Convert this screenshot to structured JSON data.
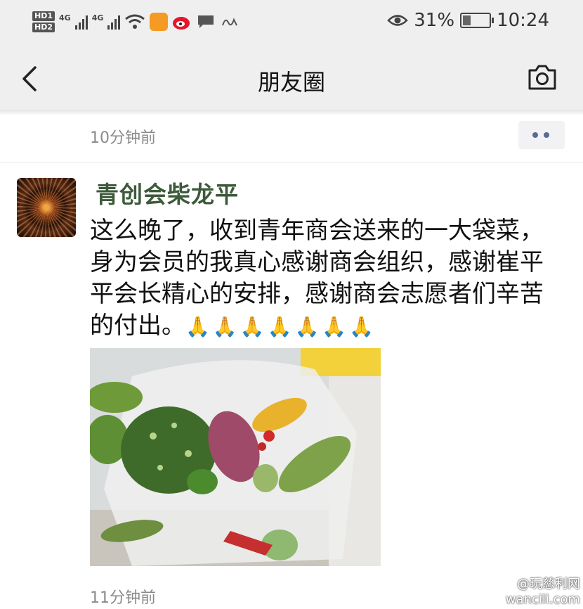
{
  "status_bar": {
    "sim1": "HD1",
    "sim2": "HD2",
    "net1": "4G",
    "net2": "4G",
    "battery_percent": "31%",
    "battery_level": 0.31,
    "time": "10:24",
    "icons": [
      "wifi-icon",
      "video-app-icon",
      "weibo-icon",
      "chat-bubble-icon",
      "app-text-icon",
      "eye-icon"
    ]
  },
  "nav": {
    "title": "朋友圈",
    "back_icon": "chevron-left-icon",
    "camera_icon": "camera-icon"
  },
  "previous_post": {
    "time": "10分钟前"
  },
  "post": {
    "author": "青创会柴龙平",
    "text": "这么晚了，收到青年商会送来的一大袋菜，身为会员的我真心感谢商会组织，感谢崔平平会长精心的安排，感谢商会志愿者们辛苦的付出。",
    "emoji": "🙏🙏🙏🙏🙏🙏🙏",
    "time": "11分钟前"
  },
  "watermark": {
    "line1": "@玩慈利网",
    "line2": "wancili.com"
  },
  "colors": {
    "author_name": "#3d5a3a",
    "link_blue": "#576b95",
    "timestamp": "#8a8a8a",
    "header_bg": "#efefef"
  }
}
